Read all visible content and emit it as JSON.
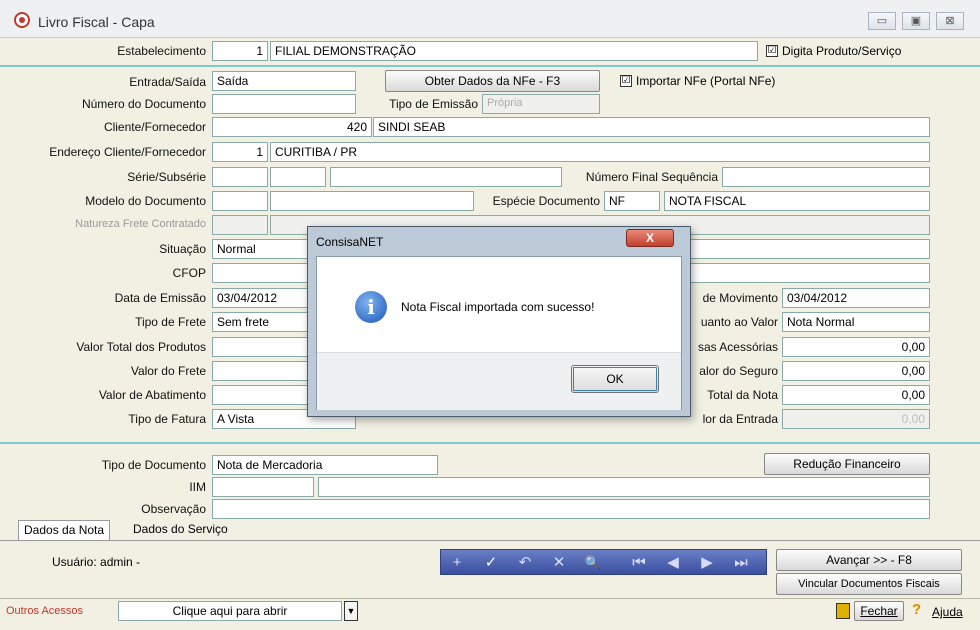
{
  "window": {
    "title": "Livro Fiscal - Capa",
    "min": "▭",
    "max": "▣",
    "close": "⊠"
  },
  "form": {
    "estabelecimento": {
      "label": "Estabelecimento",
      "code": "1",
      "name": "FILIAL DEMONSTRAÇÃO"
    },
    "digita_produto": {
      "label": "Digita Produto/Serviço",
      "checked": "☑"
    },
    "entrada_saida": {
      "label": "Entrada/Saída",
      "value": "Saída"
    },
    "obter_nfe_btn": "Obter Dados da NFe - F3",
    "importar_nfe": {
      "label": "Importar NFe (Portal NFe)",
      "checked": "☑"
    },
    "numero_documento": {
      "label": "Número do Documento",
      "value": ""
    },
    "tipo_emissao": {
      "label": "Tipo de Emissão",
      "value": "Própria"
    },
    "cliente": {
      "label": "Cliente/Fornecedor",
      "code": "420",
      "name": "SINDI SEAB"
    },
    "endereco": {
      "label": "Endereço Cliente/Fornecedor",
      "code": "1",
      "value": "CURITIBA / PR"
    },
    "serie": {
      "label": "Série/Subsérie"
    },
    "numero_final": {
      "label": "Número Final Sequência"
    },
    "modelo": {
      "label": "Modelo do Documento"
    },
    "especie": {
      "label": "Espécie Documento",
      "code": "NF",
      "value": "NOTA FISCAL"
    },
    "natureza_frete": {
      "label": "Natureza Frete Contratado"
    },
    "situacao": {
      "label": "Situação",
      "value": "Normal"
    },
    "cfop": {
      "label": "CFOP"
    },
    "data_emissao": {
      "label": "Data de Emissão",
      "value": "03/04/2012"
    },
    "data_movimento": {
      "label": "de Movimento",
      "value": "03/04/2012"
    },
    "tipo_frete": {
      "label": "Tipo de Frete",
      "value": "Sem frete"
    },
    "quanto_valor": {
      "label": "uanto ao Valor",
      "value": "Nota Normal"
    },
    "valor_total_produtos": {
      "label": "Valor Total dos Produtos"
    },
    "acessorias": {
      "label": "sas Acessórias",
      "value": "0,00"
    },
    "valor_frete": {
      "label": "Valor do Frete"
    },
    "valor_seguro": {
      "label": "alor do Seguro",
      "value": "0,00"
    },
    "valor_abatimento": {
      "label": "Valor de Abatimento"
    },
    "total_nota": {
      "label": "Total da Nota",
      "value": "0,00"
    },
    "tipo_fatura": {
      "label": "Tipo de Fatura",
      "value": "A Vista"
    },
    "valor_entrada": {
      "label": "lor da Entrada",
      "value": "0,00"
    },
    "tipo_documento": {
      "label": "Tipo de Documento",
      "value": "Nota de Mercadoria"
    },
    "reducao_btn": "Redução Financeiro",
    "iim": {
      "label": "IIM"
    },
    "observacao": {
      "label": "Observação"
    }
  },
  "tabs": [
    "Dados da Nota",
    "Dados do Serviço"
  ],
  "footer": {
    "usuario": "Usuário: admin -",
    "avancar_btn": "Avançar >> - F8",
    "vincular_btn": "Vincular Documentos Fiscais",
    "outros_acessos": "Outros Acessos",
    "dropdown_value": "Clique aqui para abrir",
    "fechar": "Fechar",
    "ajuda": "Ajuda"
  },
  "toolbar_icons": [
    "+",
    "✓",
    "↶",
    "✕",
    "🔍",
    "⏮",
    "◀",
    "▶",
    "⏭"
  ],
  "dialog": {
    "title": "ConsisaNET",
    "close": "X",
    "message": "Nota Fiscal importada com sucesso!",
    "ok": "OK",
    "icon": "i"
  },
  "colors": {
    "accent_line": "#7ec8cf",
    "toolbar": "#3a4fa0",
    "outros_acessos": "#c0392b"
  }
}
